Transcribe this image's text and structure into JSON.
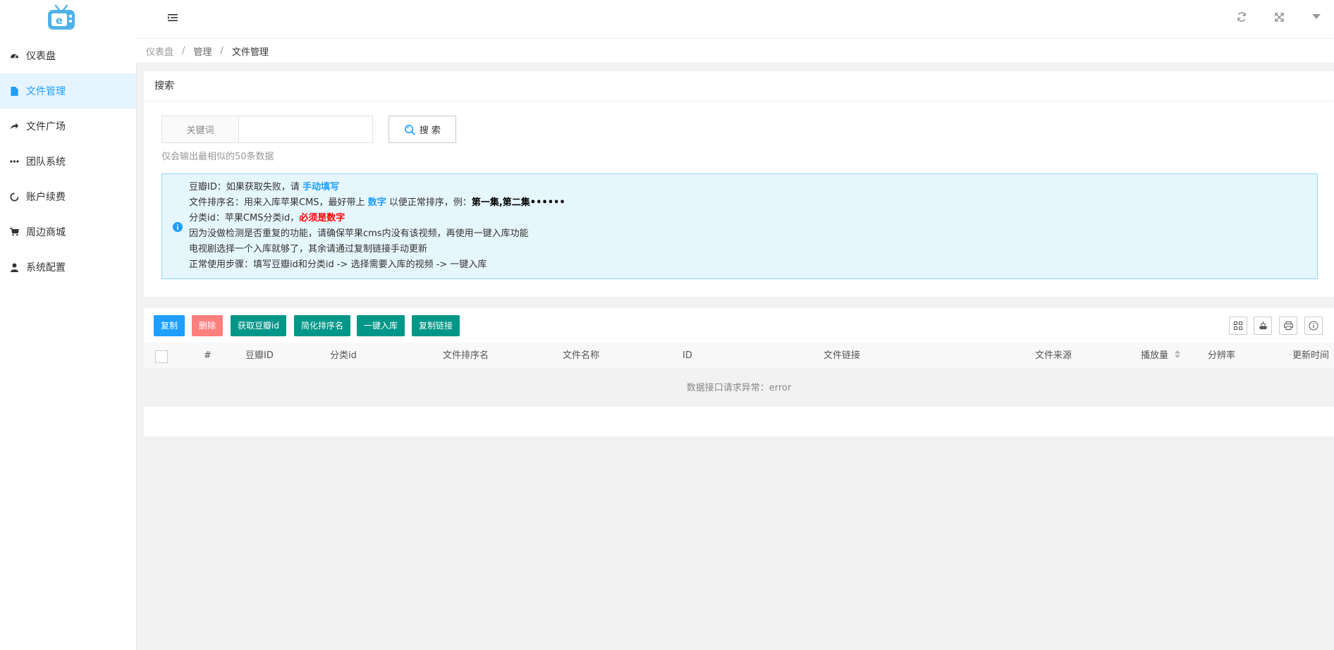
{
  "sidebar": {
    "items": [
      {
        "label": "仪表盘",
        "icon": "dashboard-icon"
      },
      {
        "label": "文件管理",
        "icon": "file-icon",
        "active": true
      },
      {
        "label": "文件广场",
        "icon": "share-icon"
      },
      {
        "label": "团队系统",
        "icon": "ellipsis-icon"
      },
      {
        "label": "账户续费",
        "icon": "circle-icon"
      },
      {
        "label": "周边商城",
        "icon": "cart-icon"
      },
      {
        "label": "系统配置",
        "icon": "user-icon"
      }
    ]
  },
  "breadcrumb": [
    "仪表盘",
    "管理",
    "文件管理"
  ],
  "search": {
    "title": "搜索",
    "keyword_label": "关键词",
    "keyword_value": "",
    "button_label": "搜 索",
    "hint": "仅会输出最相似的50条数据"
  },
  "notice": {
    "line1_prefix": "豆瓣ID：如果获取失败，请 ",
    "line1_link": "手动填写",
    "line2_prefix": "文件排序名：用来入库苹果CMS，最好带上 ",
    "line2_highlight": "数字",
    "line2_mid": " 以便正常排序，例：",
    "line2_example": "第一集,第二集••••••",
    "line3_prefix": "分类id：苹果CMS分类id，",
    "line3_warn": "必须是数字",
    "line4": "因为没做检测是否重复的功能，请确保苹果cms内没有该视频，再使用一键入库功能",
    "line5": "电视剧选择一个入库就够了，其余请通过复制链接手动更新",
    "line6": "正常使用步骤：填写豆瓣id和分类id -> 选择需要入库的视频 -> 一键入库"
  },
  "toolbar": {
    "copy": "复制",
    "delete": "删除",
    "get_douban": "获取豆瓣id",
    "simplify": "简化排序名",
    "import": "一键入库",
    "copy_link": "复制链接"
  },
  "colors": {
    "primary": "#1e9fff",
    "danger": "#ff7f7f",
    "teal": "#009688",
    "notice_bg": "#e6f6fd"
  },
  "table": {
    "columns": [
      "#",
      "豆瓣ID",
      "分类id",
      "文件排序名",
      "文件名称",
      "ID",
      "文件链接",
      "文件来源",
      "播放量",
      "分辨率",
      "更新时间"
    ],
    "empty_text": "数据接口请求异常：error"
  }
}
